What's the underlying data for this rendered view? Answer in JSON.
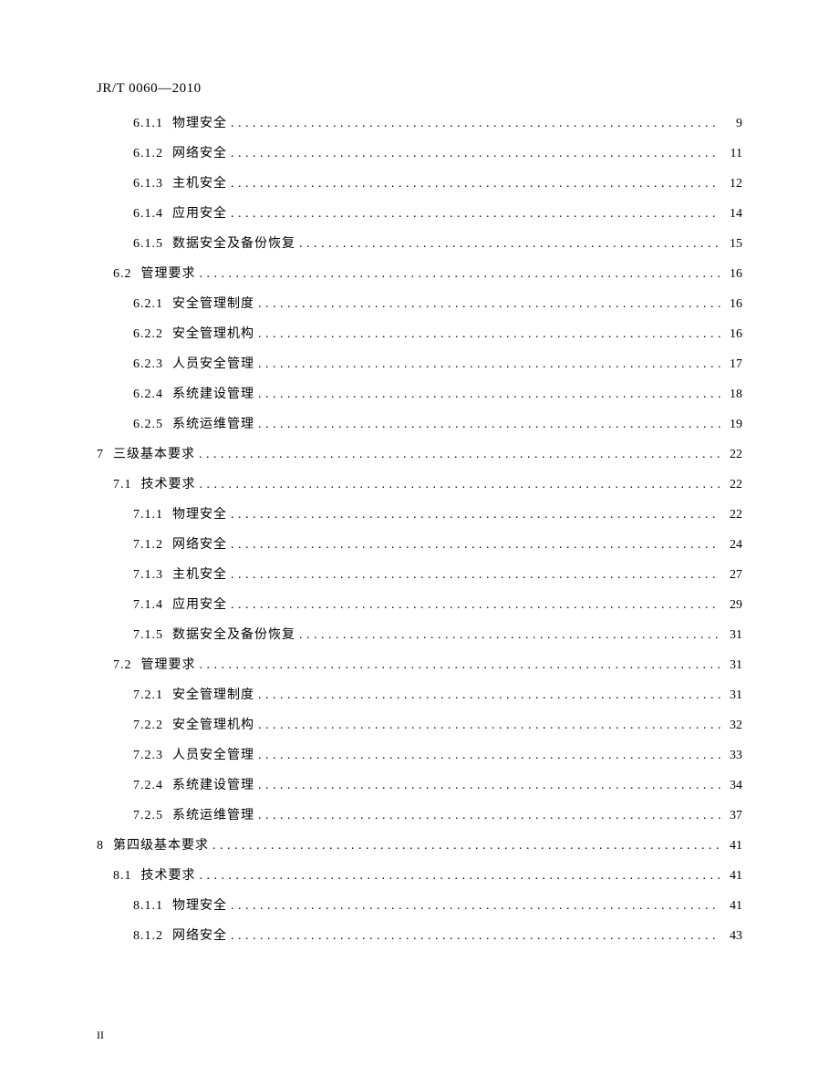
{
  "header": "JR/T 0060—2010",
  "page_marker": "II",
  "toc": [
    {
      "indent": 2,
      "num": "6.1.1",
      "title": "物理安全",
      "page": "9"
    },
    {
      "indent": 2,
      "num": "6.1.2",
      "title": "网络安全",
      "page": "11"
    },
    {
      "indent": 2,
      "num": "6.1.3",
      "title": "主机安全",
      "page": "12"
    },
    {
      "indent": 2,
      "num": "6.1.4",
      "title": "应用安全",
      "page": "14"
    },
    {
      "indent": 2,
      "num": "6.1.5",
      "title": "数据安全及备份恢复",
      "page": "15"
    },
    {
      "indent": 1,
      "num": "6.2",
      "title": "管理要求",
      "page": "16"
    },
    {
      "indent": 2,
      "num": "6.2.1",
      "title": "安全管理制度",
      "page": "16"
    },
    {
      "indent": 2,
      "num": "6.2.2",
      "title": "安全管理机构",
      "page": "16"
    },
    {
      "indent": 2,
      "num": "6.2.3",
      "title": "人员安全管理",
      "page": "17"
    },
    {
      "indent": 2,
      "num": "6.2.4",
      "title": "系统建设管理",
      "page": "18"
    },
    {
      "indent": 2,
      "num": "6.2.5",
      "title": "系统运维管理",
      "page": "19"
    },
    {
      "indent": 0,
      "num": "7",
      "title": "三级基本要求",
      "page": "22"
    },
    {
      "indent": 1,
      "num": "7.1",
      "title": "技术要求",
      "page": "22"
    },
    {
      "indent": 2,
      "num": "7.1.1",
      "title": "物理安全",
      "page": "22"
    },
    {
      "indent": 2,
      "num": "7.1.2",
      "title": "网络安全",
      "page": "24"
    },
    {
      "indent": 2,
      "num": "7.1.3",
      "title": "主机安全",
      "page": "27"
    },
    {
      "indent": 2,
      "num": "7.1.4",
      "title": "应用安全",
      "page": "29"
    },
    {
      "indent": 2,
      "num": "7.1.5",
      "title": "数据安全及备份恢复",
      "page": "31"
    },
    {
      "indent": 1,
      "num": "7.2",
      "title": "管理要求",
      "page": "31"
    },
    {
      "indent": 2,
      "num": "7.2.1",
      "title": "安全管理制度",
      "page": "31"
    },
    {
      "indent": 2,
      "num": "7.2.2",
      "title": "安全管理机构",
      "page": "32"
    },
    {
      "indent": 2,
      "num": "7.2.3",
      "title": "人员安全管理",
      "page": "33"
    },
    {
      "indent": 2,
      "num": "7.2.4",
      "title": "系统建设管理",
      "page": "34"
    },
    {
      "indent": 2,
      "num": "7.2.5",
      "title": "系统运维管理",
      "page": "37"
    },
    {
      "indent": 0,
      "num": "8",
      "title": "第四级基本要求",
      "page": "41"
    },
    {
      "indent": 1,
      "num": "8.1",
      "title": "技术要求",
      "page": "41"
    },
    {
      "indent": 2,
      "num": "8.1.1",
      "title": "物理安全",
      "page": "41"
    },
    {
      "indent": 2,
      "num": "8.1.2",
      "title": "网络安全",
      "page": "43"
    }
  ]
}
